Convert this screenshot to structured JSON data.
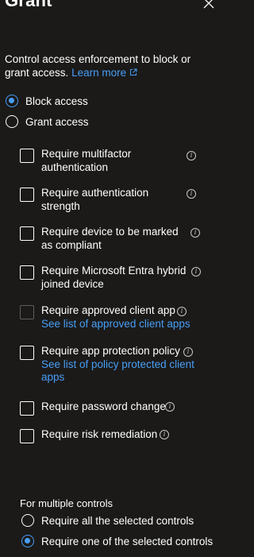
{
  "panel": {
    "title": "Grant",
    "description": "Control access enforcement to block or grant access.",
    "learn_more": "Learn more",
    "access_options": [
      {
        "label": "Block access",
        "checked": true
      },
      {
        "label": "Grant access",
        "checked": false
      }
    ],
    "controls": [
      {
        "label": "Require multifactor authentication",
        "sub": "",
        "disabled": false
      },
      {
        "label": "Require authentication strength",
        "sub": "",
        "disabled": false
      },
      {
        "label": "Require device to be marked as compliant",
        "sub": "",
        "disabled": false
      },
      {
        "label": "Require Microsoft Entra hybrid joined device",
        "sub": "",
        "disabled": false
      },
      {
        "label": "Require approved client app",
        "sub": "See list of approved client apps",
        "disabled": true
      },
      {
        "label": "Require app protection policy",
        "sub": "See list of policy protected client apps",
        "disabled": false
      },
      {
        "label": "Require password change",
        "sub": "",
        "disabled": false
      },
      {
        "label": "Require risk remediation",
        "sub": "",
        "disabled": false
      }
    ],
    "multiple_label": "For multiple controls",
    "multiple_options": [
      {
        "label": "Require all the selected controls",
        "checked": false
      },
      {
        "label": "Require one of the selected controls",
        "checked": true
      }
    ],
    "icons": {
      "close": "close-icon",
      "info": "info-icon",
      "external": "external-link-icon"
    },
    "colors": {
      "background": "#1b1a19",
      "accent": "#479ef5",
      "text": "#ffffff"
    }
  }
}
